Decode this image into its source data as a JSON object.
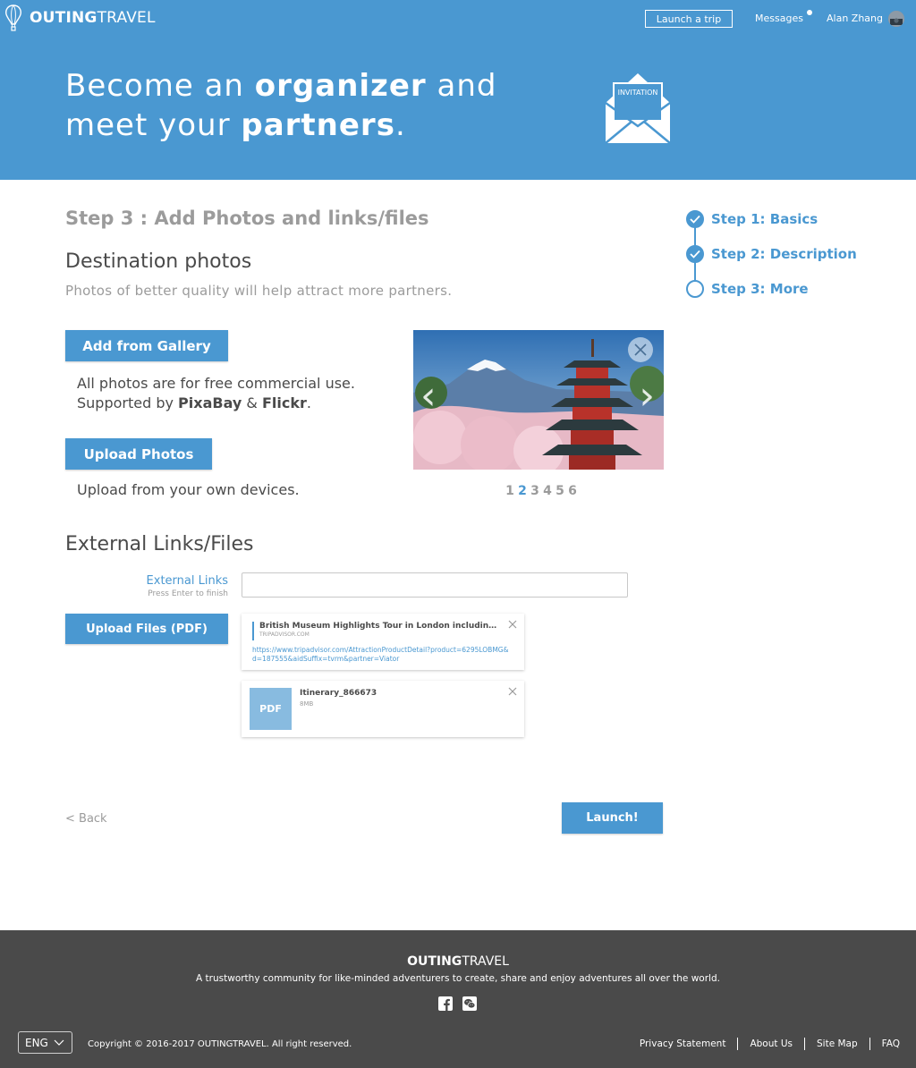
{
  "header": {
    "logo": {
      "bold": "OUTING",
      "light": "TRAVEL"
    },
    "launch_label": "Launch a trip",
    "messages_label": "Messages",
    "user_name": "Alan Zhang"
  },
  "hero": {
    "line1_a": "Become an ",
    "line1_b": "organizer",
    "line1_c": " and",
    "line2_a": "meet your ",
    "line2_b": "partners",
    "line2_c": ".",
    "envelope_label": "INVITATION"
  },
  "main": {
    "step_title": "Step 3 : Add Photos and links/files",
    "photos_title": "Destination photos",
    "photos_subtitle": "Photos of better quality will help attract more partners.",
    "gallery_button": "Add from Gallery",
    "gallery_note_line1": "All photos are for free commercial use.",
    "gallery_note_prefix": "Supported by ",
    "gallery_note_brand1": "PixaBay",
    "gallery_note_amp": " & ",
    "gallery_note_brand2": "Flickr",
    "gallery_note_end": ".",
    "upload_photos_button": "Upload Photos",
    "upload_note": "Upload from your own devices.",
    "pager": [
      "1",
      "2",
      "3",
      "4",
      "5",
      "6"
    ],
    "pager_active": "2",
    "links_title": "External Links/Files",
    "ext_links_label": "External Links",
    "ext_links_hint": "Press Enter to finish",
    "ext_links_value": "",
    "upload_files_button": "Upload Files (PDF)",
    "link_card": {
      "title": "British Museum Highlights Tour in London including the ...",
      "source": "TRIPADVISOR.COM",
      "url": "https://www.tripadvisor.com/AttractionProductDetail?product=6295LOBMG&d=187555&aidSuffix=tvrm&partner=Viator"
    },
    "file_card": {
      "thumb": "PDF",
      "name": "Itinerary_866673",
      "size": "8MB"
    },
    "back_label": "< Back",
    "launch_button": "Launch!"
  },
  "steps": [
    {
      "label": "Step 1: Basics",
      "done": true
    },
    {
      "label": "Step 2: Description",
      "done": true
    },
    {
      "label": "Step 3: More",
      "done": false
    }
  ],
  "footer": {
    "logo": {
      "bold": "OUTING",
      "light": "TRAVEL"
    },
    "tagline": "A trustworthy community for like-minded adventurers to create, share and enjoy adventures all over the world.",
    "language": "ENG",
    "copyright": "Copyright © 2016-2017 OUTINGTRAVEL. All right reserved.",
    "links": [
      "Privacy Statement",
      "About Us",
      "Site Map",
      "FAQ"
    ]
  },
  "icons": {
    "logo": "hot-air-balloon-icon",
    "envelope": "invitation-envelope-icon",
    "social": [
      "facebook-icon",
      "wechat-icon"
    ]
  },
  "colors": {
    "brand_blue": "#4a98d1",
    "footer_bg": "#4a4a4a",
    "muted_text": "#9b9b9b"
  }
}
